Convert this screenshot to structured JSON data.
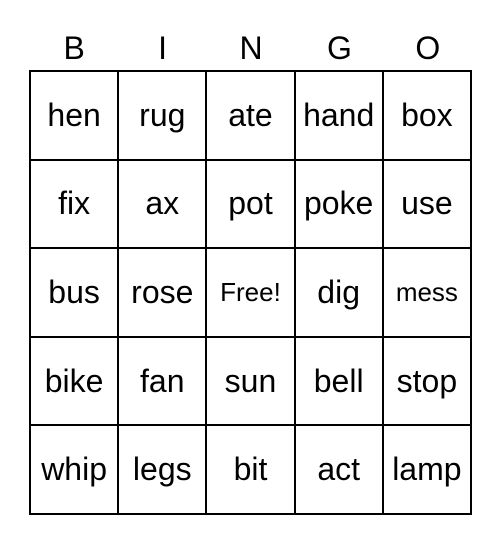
{
  "header": [
    "B",
    "I",
    "N",
    "G",
    "O"
  ],
  "rows": [
    [
      "hen",
      "rug",
      "ate",
      "hand",
      "box"
    ],
    [
      "fix",
      "ax",
      "pot",
      "poke",
      "use"
    ],
    [
      "bus",
      "rose",
      "Free!",
      "dig",
      "mess"
    ],
    [
      "bike",
      "fan",
      "sun",
      "bell",
      "stop"
    ],
    [
      "whip",
      "legs",
      "bit",
      "act",
      "lamp"
    ]
  ],
  "small_cells": [
    "2-2",
    "2-4"
  ]
}
